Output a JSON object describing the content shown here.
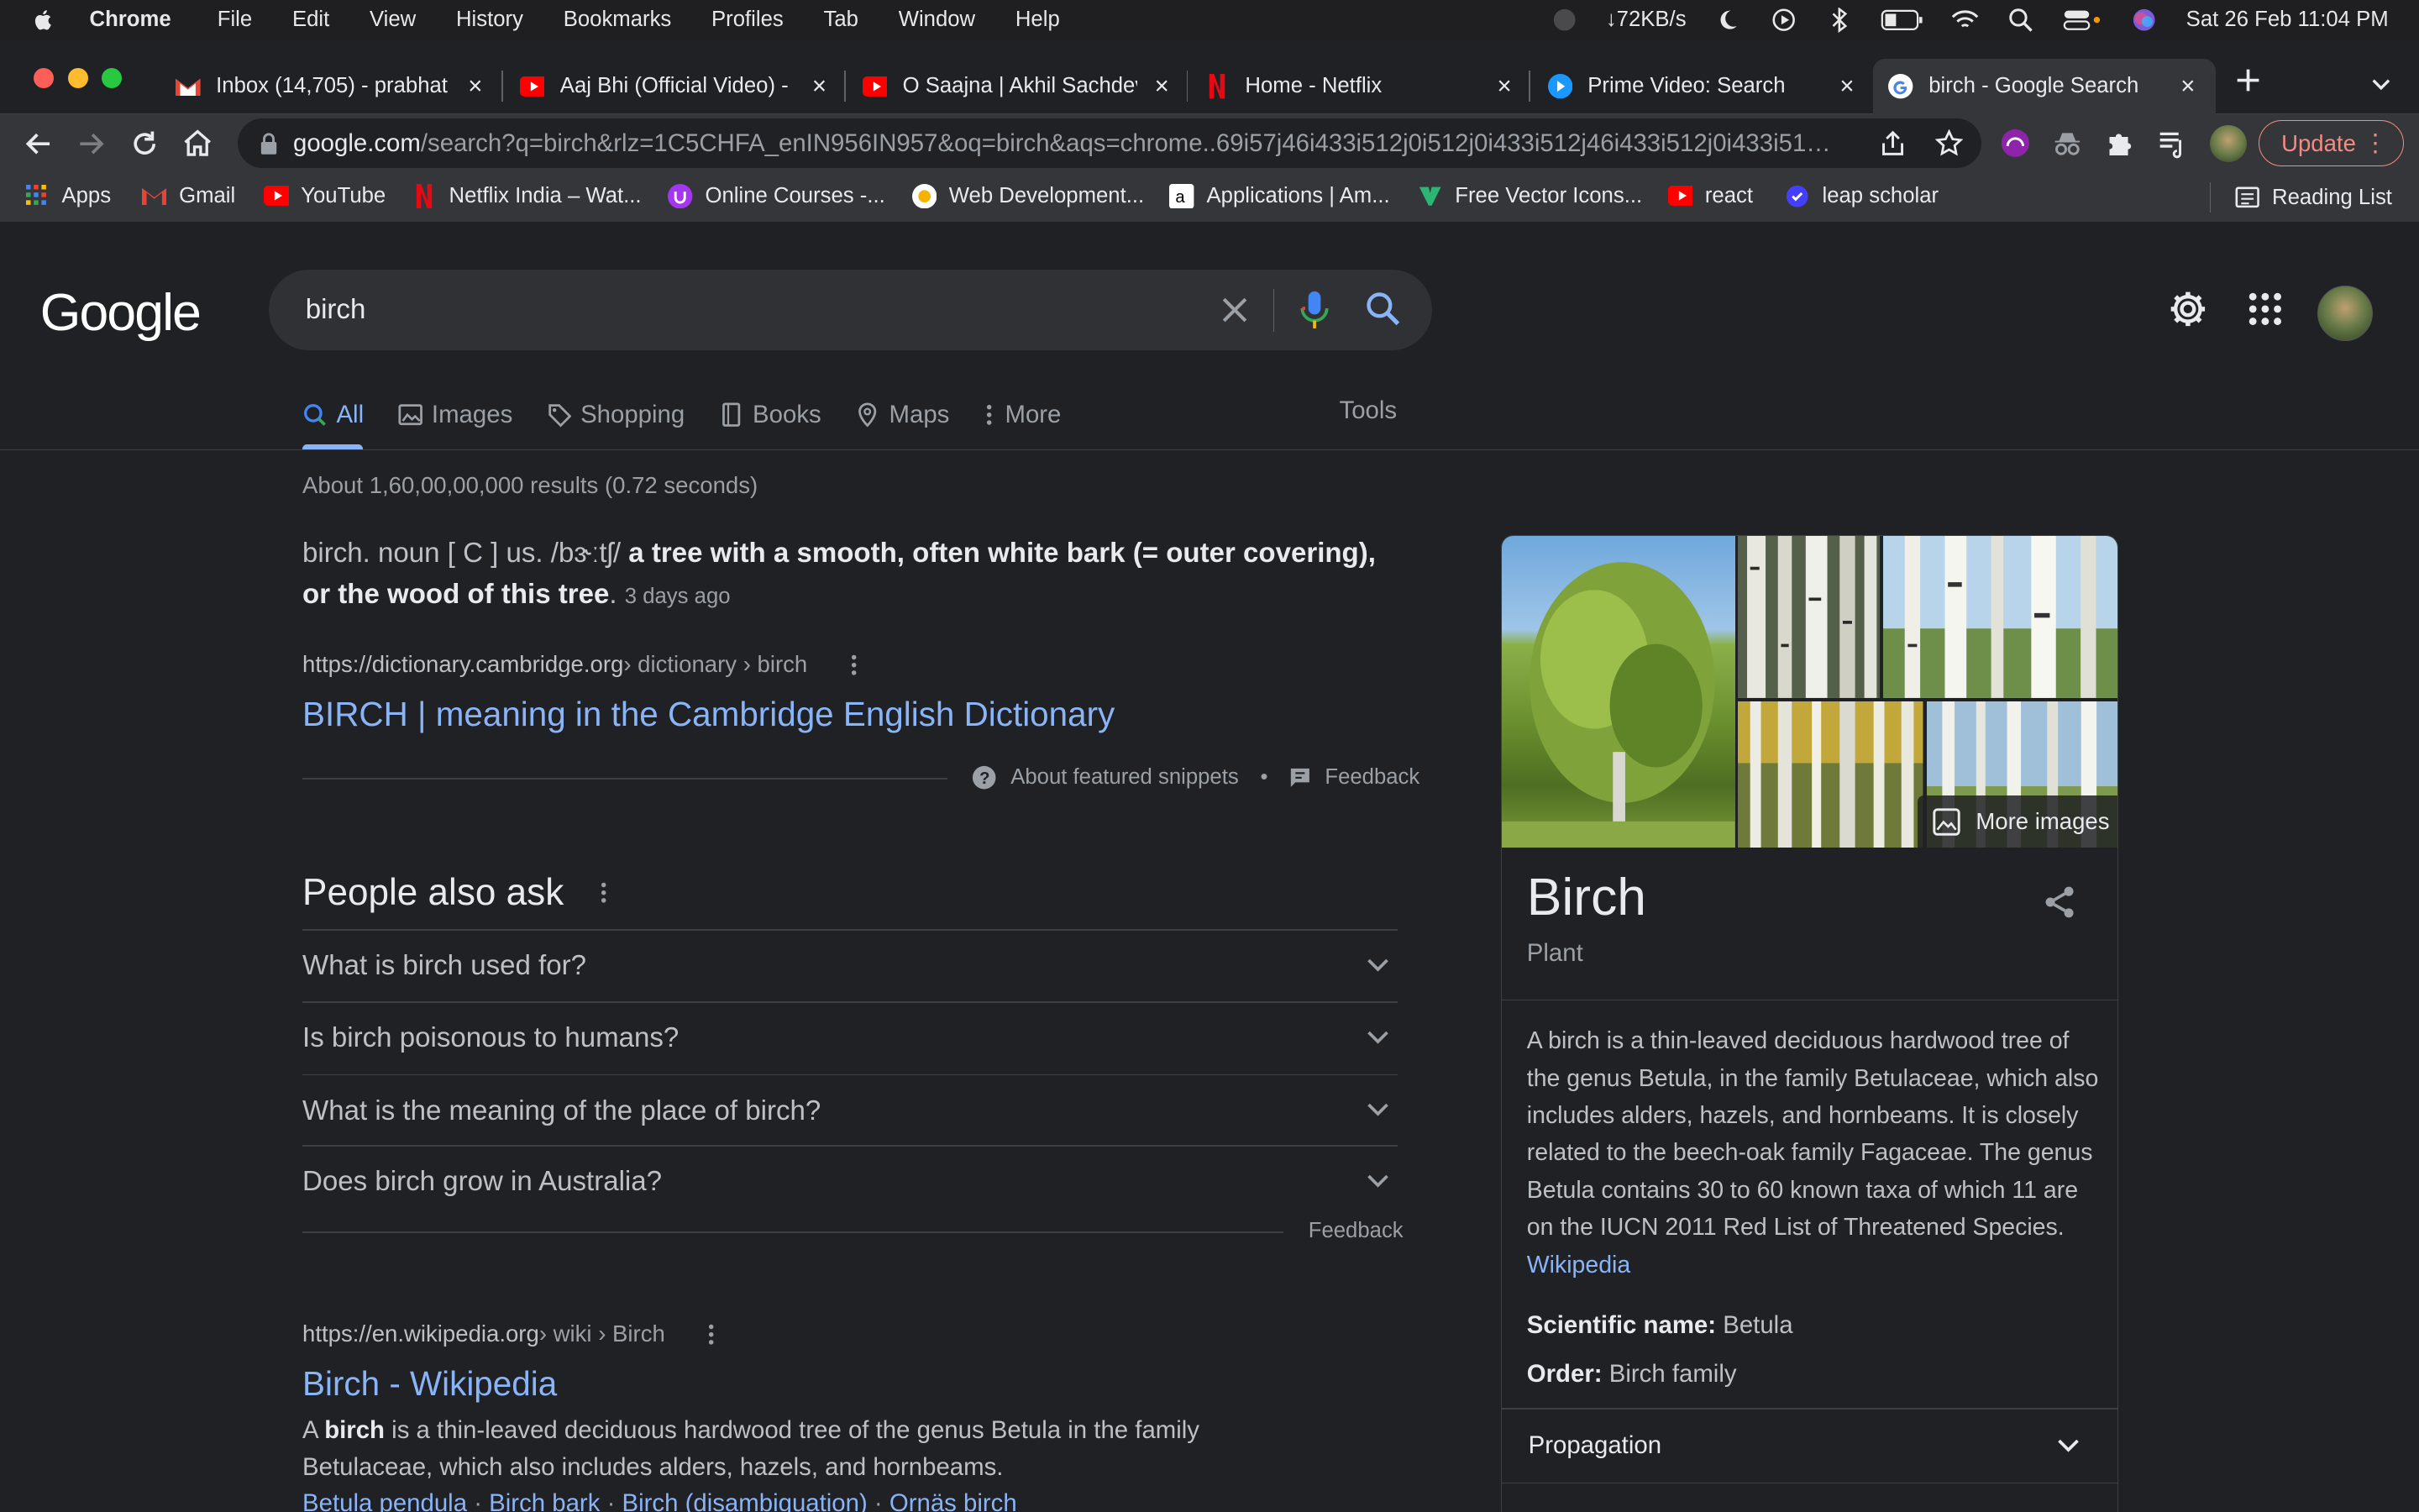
{
  "menubar": {
    "app": "Chrome",
    "items": [
      "File",
      "Edit",
      "View",
      "History",
      "Bookmarks",
      "Profiles",
      "Tab",
      "Window",
      "Help"
    ],
    "network": "↓72KB/s",
    "datetime": "Sat 26 Feb  11:04 PM"
  },
  "tabs": [
    {
      "title": "Inbox (14,705) - prabhat",
      "icon": "gmail-icon"
    },
    {
      "title": "Aaj Bhi (Official Video) -",
      "icon": "youtube-icon"
    },
    {
      "title": "O Saajna | Akhil Sachdev",
      "icon": "youtube-icon"
    },
    {
      "title": "Home - Netflix",
      "icon": "netflix-icon"
    },
    {
      "title": "Prime Video: Search",
      "icon": "prime-video-icon"
    },
    {
      "title": "birch - Google Search",
      "icon": "google-icon",
      "active": true
    }
  ],
  "toolbar": {
    "url_host": "google.com",
    "url_rest": "/search?q=birch&rlz=1C5CHFA_enIN956IN957&oq=birch&aqs=chrome..69i57j46i433i512j0i512j0i433i512j46i433i512j0i433i51…",
    "update_label": "Update"
  },
  "bookmarks": [
    {
      "label": "Apps",
      "icon": "apps-grid-icon"
    },
    {
      "label": "Gmail",
      "icon": "gmail-icon"
    },
    {
      "label": "YouTube",
      "icon": "youtube-icon"
    },
    {
      "label": "Netflix India – Wat...",
      "icon": "netflix-icon"
    },
    {
      "label": "Online Courses -...",
      "icon": "udemy-icon"
    },
    {
      "label": "Web Development...",
      "icon": "web-dev-icon"
    },
    {
      "label": "Applications | Am...",
      "icon": "amazon-icon"
    },
    {
      "label": "Free Vector Icons...",
      "icon": "vector-icon"
    },
    {
      "label": "react",
      "icon": "youtube-icon"
    },
    {
      "label": "leap scholar",
      "icon": "leap-icon"
    }
  ],
  "reading_list": "Reading List",
  "google": {
    "logo": "Google",
    "query": "birch",
    "tabs": [
      "All",
      "Images",
      "Shopping",
      "Books",
      "Maps",
      "More"
    ],
    "tools": "Tools",
    "stats": "About 1,60,00,00,000 results (0.72 seconds)"
  },
  "featured_snippet": {
    "lead": "birch. noun [ C ] us. /bɝːtʃ/",
    "bold": "a tree with a smooth, often white bark (= outer covering), or the wood of this tree",
    "date": "3 days ago",
    "cite_host": "https://dictionary.cambridge.org",
    "cite_path": " › dictionary › birch",
    "title": "BIRCH | meaning in the Cambridge English Dictionary",
    "about": "About featured snippets",
    "feedback": "Feedback"
  },
  "paa": {
    "title": "People also ask",
    "questions": [
      "What is birch used for?",
      "Is birch poisonous to humans?",
      "What is the meaning of the place of birch?",
      "Does birch grow in Australia?"
    ],
    "feedback": "Feedback"
  },
  "wiki_result": {
    "cite_host": "https://en.wikipedia.org",
    "cite_path": " › wiki › Birch",
    "title": "Birch - Wikipedia",
    "snippet_pre": "A ",
    "snippet_bold": "birch",
    "snippet_post": " is a thin-leaved deciduous hardwood tree of the genus Betula in the family Betulaceae, which also includes alders, hazels, and hornbeams.",
    "sublinks": [
      "Betula pendula",
      "Birch bark",
      "Birch (disambiguation)",
      "Ornäs birch"
    ]
  },
  "knowledge_panel": {
    "more_images": "More images",
    "title": "Birch",
    "subtitle": "Plant",
    "description": "A birch is a thin-leaved deciduous hardwood tree of the genus Betula, in the family Betulaceae, which also includes alders, hazels, and hornbeams. It is closely related to the beech-oak family Fagaceae. The genus Betula contains 30 to 60 known taxa of which 11 are on the IUCN 2011 Red List of Threatened Species.",
    "source": "Wikipedia",
    "facts": [
      {
        "label": "Scientific name:",
        "value": "Betula"
      },
      {
        "label": "Order:",
        "value": "Birch family"
      }
    ],
    "expand": "Propagation"
  }
}
